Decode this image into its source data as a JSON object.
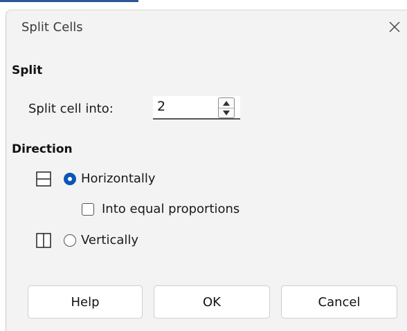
{
  "window": {
    "title": "Split Cells",
    "close_icon": "close-icon"
  },
  "split_section": {
    "heading": "Split",
    "split_cell_label": "Split cell into:",
    "split_cell_value": "2",
    "spin_up_icon": "triangle-up-icon",
    "spin_down_icon": "triangle-down-icon"
  },
  "direction_section": {
    "heading": "Direction",
    "horizontally": {
      "label": "Horizontally",
      "checked": true,
      "icon": "split-horizontal-icon"
    },
    "equal_proportions": {
      "label": "Into equal proportions",
      "checked": false
    },
    "vertically": {
      "label": "Vertically",
      "checked": false,
      "icon": "split-vertical-icon"
    }
  },
  "buttons": {
    "help": "Help",
    "ok": "OK",
    "cancel": "Cancel"
  },
  "colors": {
    "radio_selected": "#0a56b8",
    "dialog_background": "#f3f3f3"
  }
}
